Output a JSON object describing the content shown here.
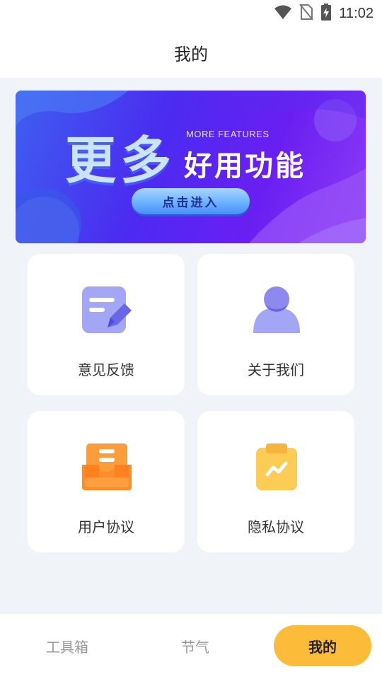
{
  "status_bar": {
    "time": "11:02",
    "icons": [
      "wifi-icon",
      "no-sim-icon",
      "battery-charging-icon"
    ]
  },
  "header": {
    "title": "我的"
  },
  "banner": {
    "big_text": "更多",
    "sub_text": "MORE FEATURES",
    "feature_text": "好用功能",
    "button_label": "点击进入",
    "colors": {
      "start": "#3e5ff0",
      "mid": "#4b2bf0",
      "end": "#8d3cf5"
    }
  },
  "grid": {
    "items": [
      {
        "label": "意见反馈",
        "icon": "feedback-edit-icon",
        "color": "#a3a6f5"
      },
      {
        "label": "关于我们",
        "icon": "user-person-icon",
        "color": "#a3a6f5"
      },
      {
        "label": "用户协议",
        "icon": "inbox-tray-icon",
        "color": "#fb8e2a"
      },
      {
        "label": "隐私协议",
        "icon": "clipboard-icon",
        "color": "#fdcc55"
      }
    ]
  },
  "bottom_nav": {
    "items": [
      {
        "label": "工具箱",
        "active": false
      },
      {
        "label": "节气",
        "active": false
      },
      {
        "label": "我的",
        "active": true
      }
    ],
    "active_color": "#fdbb3a"
  }
}
